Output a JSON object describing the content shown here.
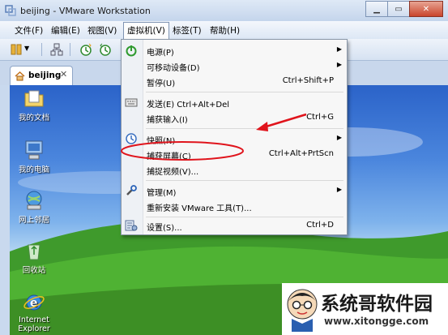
{
  "window": {
    "title": "beijing - VMware Workstation"
  },
  "colors": {
    "accent": "#3a6fd0",
    "annotation": "#e0141c",
    "menu_bg": "#f7f7f7"
  },
  "menubar": {
    "items": [
      "文件(F)",
      "编辑(E)",
      "视图(V)",
      "虚拟机(V)",
      "标签(T)",
      "帮助(H)"
    ]
  },
  "tab": {
    "label": "beijing"
  },
  "desktop": {
    "icons": [
      "我的文档",
      "我的电脑",
      "网上邻居",
      "回收站",
      "Internet Explorer"
    ]
  },
  "menu": {
    "items": [
      {
        "label": "电源(P)",
        "shortcut": "",
        "submenu": true,
        "icon": "power-icon"
      },
      {
        "label": "可移动设备(D)",
        "shortcut": "",
        "submenu": true,
        "icon": ""
      },
      {
        "label": "暂停(U)",
        "shortcut": "Ctrl+Shift+P",
        "submenu": false,
        "icon": ""
      },
      {
        "label": "发送(E) Ctrl+Alt+Del",
        "shortcut": "",
        "submenu": false,
        "icon": "keyboard-icon"
      },
      {
        "label": "捕获输入(I)",
        "shortcut": "Ctrl+G",
        "submenu": false,
        "icon": ""
      },
      {
        "label": "快照(N)",
        "shortcut": "",
        "submenu": true,
        "icon": "snapshot-icon"
      },
      {
        "label": "捕获屏幕(C)",
        "shortcut": "Ctrl+Alt+PrtScn",
        "submenu": false,
        "icon": ""
      },
      {
        "label": "捕捉视频(V)...",
        "shortcut": "",
        "submenu": false,
        "icon": ""
      },
      {
        "label": "管理(M)",
        "shortcut": "",
        "submenu": true,
        "icon": "wrench-icon"
      },
      {
        "label": "重新安装 VMware 工具(T)...",
        "shortcut": "",
        "submenu": false,
        "icon": ""
      },
      {
        "label": "设置(S)...",
        "shortcut": "Ctrl+D",
        "submenu": false,
        "icon": "settings-icon"
      }
    ]
  },
  "watermark": {
    "name": "系统哥软件园",
    "url": "www.xitongge.com"
  }
}
